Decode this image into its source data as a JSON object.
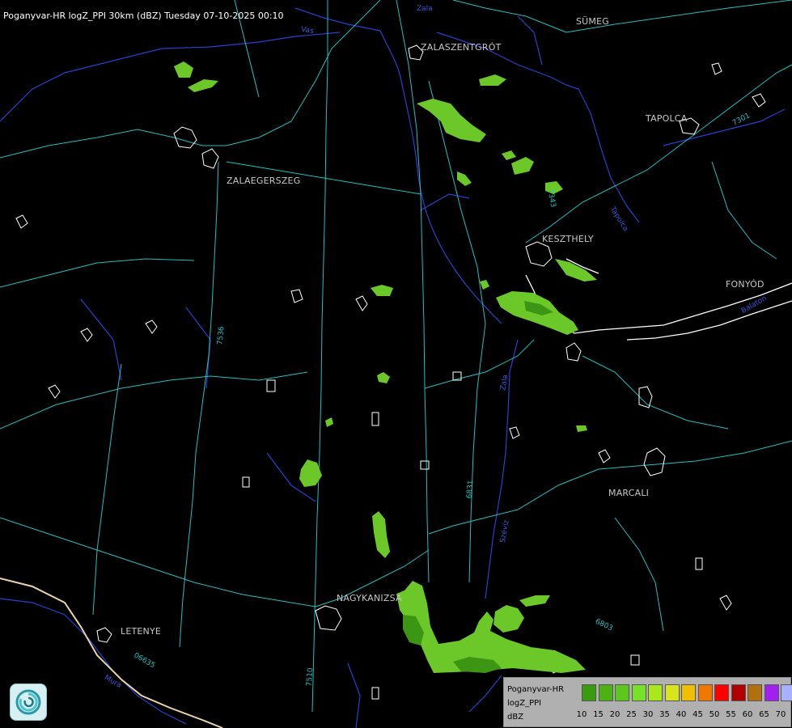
{
  "title": "Poganyvar-HR logZ_PPI 30km (dBZ) Tuesday 07-10-2025 00:10",
  "towns": [
    {
      "key": "sumeg",
      "label": "SÜMEG"
    },
    {
      "key": "zalaszentgrot",
      "label": "ZALASZENTGRÓT"
    },
    {
      "key": "tapolca",
      "label": "TAPOLCA"
    },
    {
      "key": "zalaegerszeg",
      "label": "ZALAEGERSZEG"
    },
    {
      "key": "keszthely",
      "label": "KESZTHELY"
    },
    {
      "key": "fonyod",
      "label": "FONYÓD"
    },
    {
      "key": "marcali",
      "label": "MARCALI"
    },
    {
      "key": "nagykanizsa",
      "label": "NAGYKANIZSA"
    },
    {
      "key": "letenye",
      "label": "LETENYE"
    }
  ],
  "road_labels": [
    "7301",
    "7343",
    "7536",
    "6831",
    "6803",
    "06635",
    "7510"
  ],
  "river_labels": [
    "Zala",
    "Vas",
    "Tapolca",
    "Zala",
    "Balaton",
    "Szévíz",
    "Mura"
  ],
  "legend": {
    "line1": "Poganyvar-HR",
    "line2": "logZ_PPI",
    "line3": "dBZ",
    "ticks": [
      "10",
      "15",
      "20",
      "25",
      "30",
      "35",
      "40",
      "45",
      "50",
      "55",
      "60",
      "65",
      "70"
    ],
    "colors": [
      "#3a9a10",
      "#4cb214",
      "#5cc81c",
      "#78e028",
      "#a8e81c",
      "#d8e41c",
      "#f0c000",
      "#f07800",
      "#ff0000",
      "#b00000",
      "#b07010",
      "#a020f0",
      "#a8b0ff"
    ]
  },
  "colors": {
    "road": "#20c0c0",
    "river": "#3c55d8",
    "border": "#ffffff",
    "echo_light": "#6cc828",
    "echo_dark": "#3c9614"
  }
}
